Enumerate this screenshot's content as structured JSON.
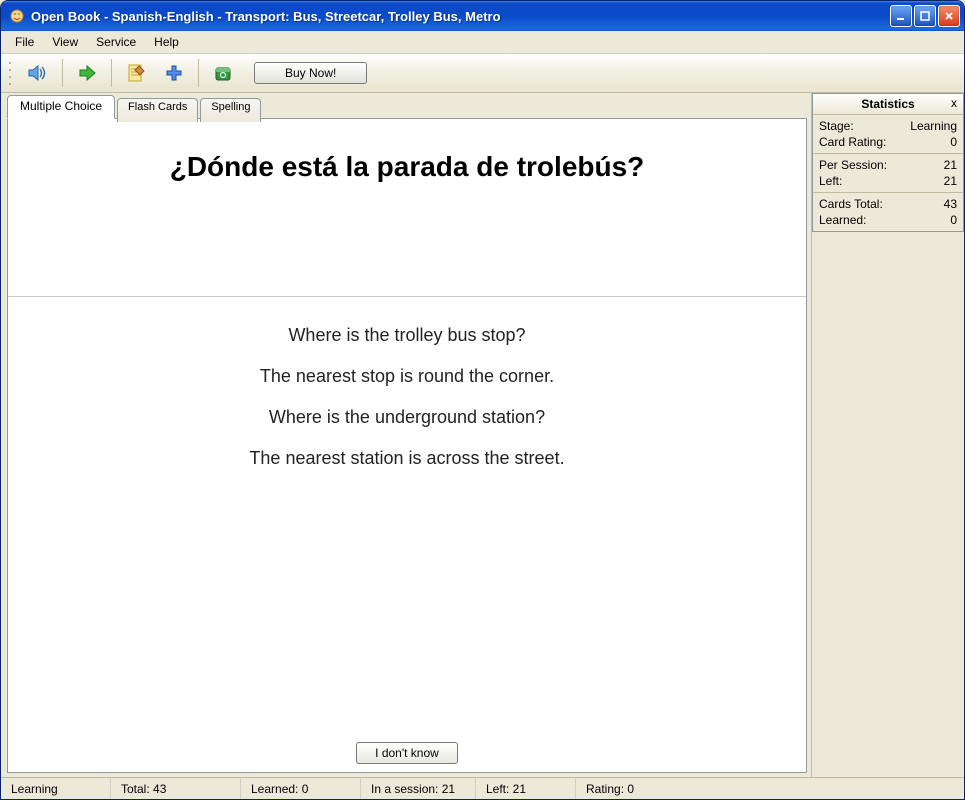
{
  "window": {
    "title": "Open Book - Spanish-English - Transport: Bus, Streetcar, Trolley Bus, Metro"
  },
  "menu": {
    "file": "File",
    "view": "View",
    "service": "Service",
    "help": "Help"
  },
  "toolbar": {
    "buy_now": "Buy Now!"
  },
  "tabs": {
    "multiple_choice": "Multiple Choice",
    "flash_cards": "Flash Cards",
    "spelling": "Spelling"
  },
  "card": {
    "question": "¿Dónde está la parada de trolebús?",
    "answers": [
      "Where is the trolley bus stop?",
      "The nearest stop is round the corner.",
      "Where is the underground station?",
      "The nearest station is across the street."
    ],
    "dont_know": "I don't know"
  },
  "stats": {
    "title": "Statistics",
    "stage_label": "Stage:",
    "stage_value": "Learning",
    "card_rating_label": "Card Rating:",
    "card_rating_value": "0",
    "per_session_label": "Per Session:",
    "per_session_value": "21",
    "left_label": "Left:",
    "left_value": "21",
    "cards_total_label": "Cards Total:",
    "cards_total_value": "43",
    "learned_label": "Learned:",
    "learned_value": "0"
  },
  "status": {
    "mode": "Learning",
    "total": "Total: 43",
    "learned": "Learned: 0",
    "in_session": "In a session: 21",
    "left": "Left: 21",
    "rating": "Rating: 0"
  }
}
